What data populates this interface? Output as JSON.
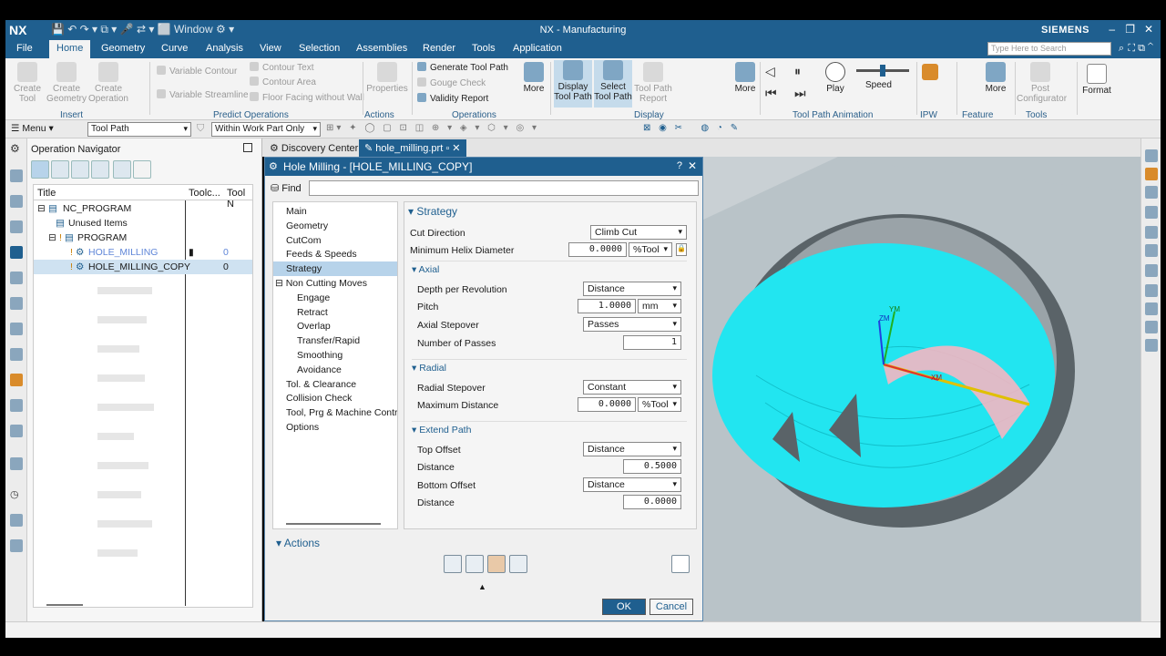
{
  "titlebar": {
    "logo": "NX",
    "window_menu": "Window",
    "title": "NX - Manufacturing",
    "brand": "SIEMENS"
  },
  "menu": {
    "tabs": [
      "File",
      "Home",
      "Geometry",
      "Curve",
      "Analysis",
      "View",
      "Selection",
      "Assemblies",
      "Render",
      "Tools",
      "Application"
    ],
    "active": "Home",
    "search_placeholder": "Type Here to Search"
  },
  "ribbon": {
    "insert": {
      "create_tool": "Create\nTool",
      "create_geometry": "Create\nGeometry",
      "create_operation": "Create\nOperation",
      "group": "Insert"
    },
    "predict": {
      "variable_contour": "Variable Contour",
      "variable_streamline": "Variable Streamline",
      "contour_text": "Contour Text",
      "contour_area": "Contour Area",
      "floor_facing": "Floor Facing without Wall",
      "group": "Predict Operations"
    },
    "actions": {
      "properties": "Properties",
      "group": "Actions"
    },
    "operations": {
      "generate_tool_path": "Generate Tool Path",
      "gouge_check": "Gouge Check",
      "validity_report": "Validity Report",
      "more": "More",
      "group": "Operations"
    },
    "display": {
      "display_tool_path": "Display\nTool Path",
      "select_tool_path": "Select\nTool Path",
      "tool_path_report": "Tool Path\nReport",
      "more": "More",
      "group": "Display"
    },
    "animation": {
      "play": "Play",
      "speed": "Speed",
      "group": "Tool Path Animation"
    },
    "ipw": {
      "group": "IPW"
    },
    "feature": {
      "more": "More",
      "group": "Feature"
    },
    "tools": {
      "post_configurator": "Post\nConfigurator",
      "group": "Tools"
    },
    "format": {
      "label": "Format"
    }
  },
  "toolbar2": {
    "menu": "Menu",
    "filter": "Tool Path",
    "scope": "Within Work Part Only"
  },
  "navigator": {
    "title": "Operation Navigator",
    "columns": [
      "Title",
      "Toolc...",
      "Tool N"
    ],
    "rows": [
      {
        "name": "NC_PROGRAM",
        "num": ""
      },
      {
        "name": "Unused Items",
        "num": ""
      },
      {
        "name": "PROGRAM",
        "num": ""
      },
      {
        "name": "HOLE_MILLING",
        "num": "0"
      },
      {
        "name": "HOLE_MILLING_COPY",
        "num": "0"
      }
    ]
  },
  "doctabs": {
    "discovery": "Discovery Center",
    "file": "hole_milling.prt"
  },
  "dialog": {
    "title": "Hole Milling - [HOLE_MILLING_COPY]",
    "find": "Find",
    "pages": [
      "Main",
      "Geometry",
      "CutCom",
      "Feeds & Speeds",
      "Strategy",
      "Non Cutting Moves",
      "Engage",
      "Retract",
      "Overlap",
      "Transfer/Rapid",
      "Smoothing",
      "Avoidance",
      "Tol. & Clearance",
      "Collision Check",
      "Tool, Prg & Machine Contro",
      "Options"
    ],
    "selected_page": "Strategy",
    "strategy": {
      "header": "Strategy",
      "cut_direction_label": "Cut Direction",
      "cut_direction": "Climb Cut",
      "min_helix_label": "Minimum Helix Diameter",
      "min_helix": "0.0000",
      "min_helix_unit": "%Tool",
      "axial": {
        "header": "Axial",
        "depth_label": "Depth per Revolution",
        "depth": "Distance",
        "pitch_label": "Pitch",
        "pitch": "1.0000",
        "pitch_unit": "mm",
        "stepover_label": "Axial Stepover",
        "stepover": "Passes",
        "passes_label": "Number of Passes",
        "passes": "1"
      },
      "radial": {
        "header": "Radial",
        "stepover_label": "Radial Stepover",
        "stepover": "Constant",
        "max_dist_label": "Maximum Distance",
        "max_dist": "0.0000",
        "max_dist_unit": "%Tool"
      },
      "extend": {
        "header": "Extend Path",
        "top_offset_label": "Top Offset",
        "top_offset": "Distance",
        "top_dist_label": "Distance",
        "top_dist": "0.5000",
        "bottom_offset_label": "Bottom Offset",
        "bottom_offset": "Distance",
        "bottom_dist_label": "Distance",
        "bottom_dist": "0.0000"
      }
    },
    "actions_header": "Actions",
    "ok": "OK",
    "cancel": "Cancel"
  },
  "viewport": {
    "axis_zm": "ZM",
    "axis_ym": "YM",
    "axis_xm": "XM",
    "toolpath_color": "#22e5f0"
  }
}
